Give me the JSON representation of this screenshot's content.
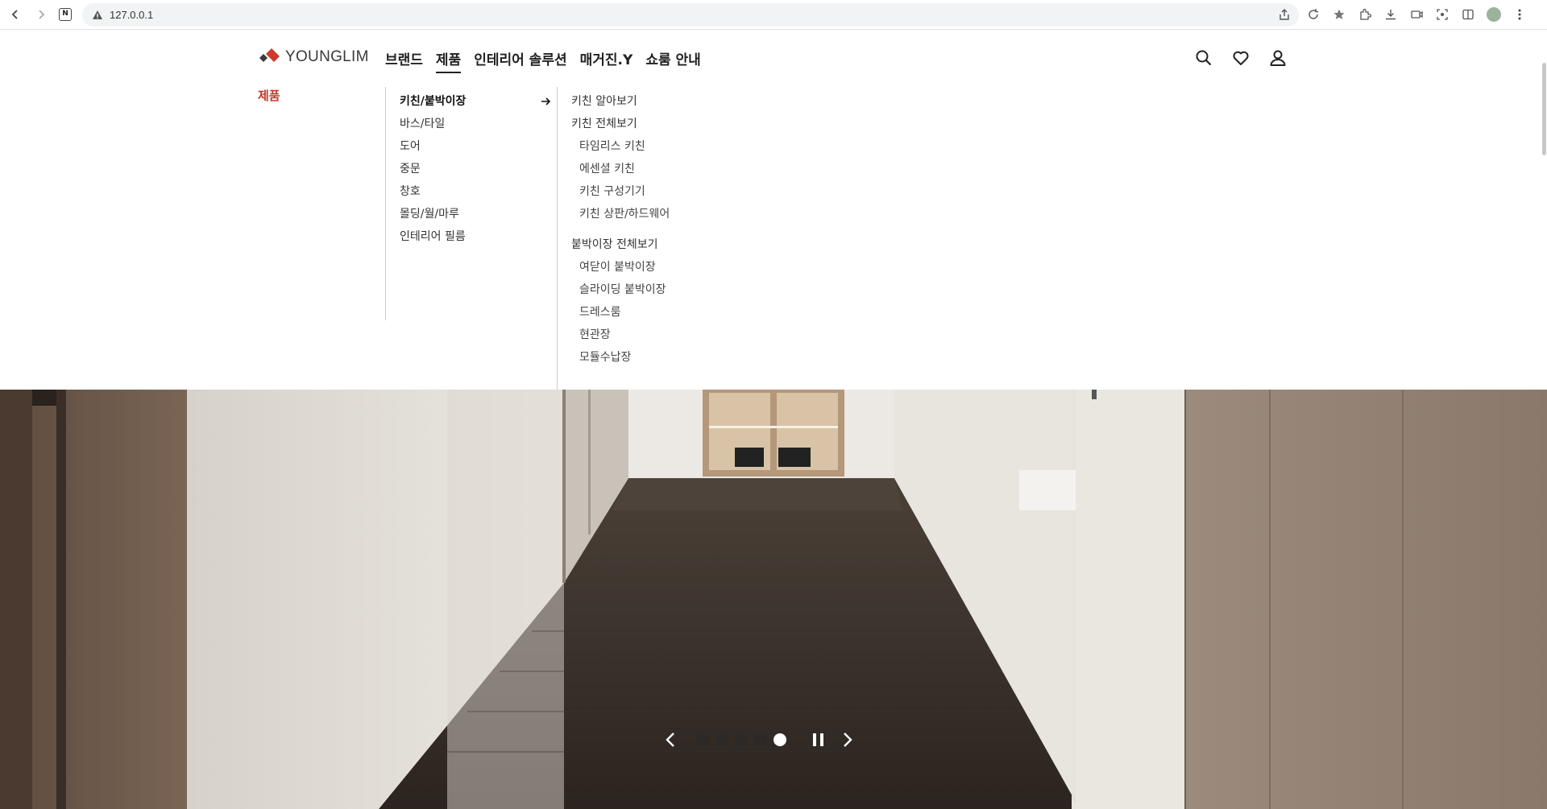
{
  "browser": {
    "url": "127.0.0.1"
  },
  "site": {
    "logo_text": "YOUNGLIM",
    "nav": [
      {
        "label": "브랜드"
      },
      {
        "label": "제품"
      },
      {
        "label": "인테리어 솔루션"
      },
      {
        "label": "매거진.Y"
      },
      {
        "label": "쇼룸 안내"
      }
    ],
    "utils": [
      "search-icon",
      "heart-icon",
      "user-icon"
    ]
  },
  "mega_menu": {
    "category_title": "제품",
    "level1": [
      {
        "label": "키친/붙박이장",
        "active": true
      },
      {
        "label": "바스/타일"
      },
      {
        "label": "도어"
      },
      {
        "label": "중문"
      },
      {
        "label": "창호"
      },
      {
        "label": "몰딩/월/마루"
      },
      {
        "label": "인테리어 필름"
      }
    ],
    "kitchen_group": {
      "items": [
        {
          "label": "키친 알아보기"
        },
        {
          "label": "키친 전체보기"
        }
      ],
      "subs": [
        {
          "label": "타임리스 키친"
        },
        {
          "label": "에센셜 키친"
        },
        {
          "label": "키친 구성기기"
        },
        {
          "label": "키친 상판/하드웨어"
        }
      ]
    },
    "closet_group": {
      "title": "붙박이장 전체보기",
      "subs": [
        {
          "label": "여닫이 붙박이장"
        },
        {
          "label": "슬라이딩 붙박이장"
        },
        {
          "label": "드레스룸"
        },
        {
          "label": "현관장"
        },
        {
          "label": "모듈수납장"
        }
      ]
    }
  },
  "slider": {
    "total": 5,
    "current": 5
  },
  "colors": {
    "accent": "#c0392b",
    "logo_red": "#d0392e"
  }
}
